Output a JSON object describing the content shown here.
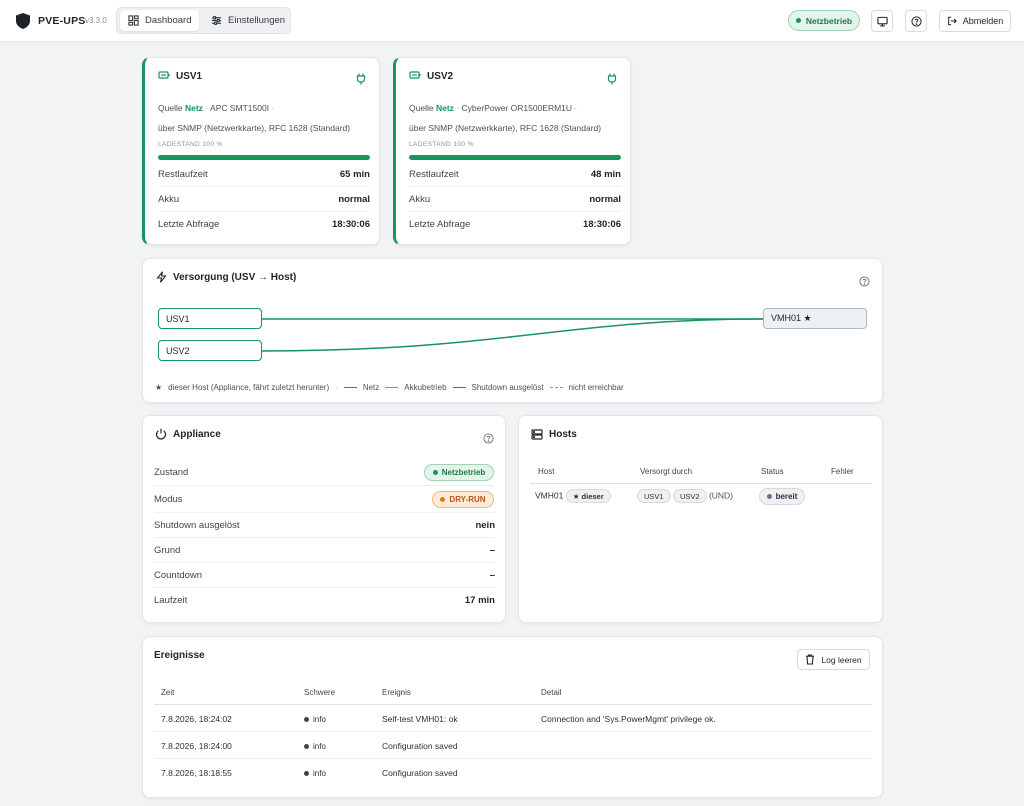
{
  "header": {
    "app_title": "PVE-UPS",
    "version": "v3.3.0",
    "tabs": [
      {
        "label": "Dashboard",
        "active": true
      },
      {
        "label": "Einstellungen",
        "active": false
      }
    ],
    "status_pill": "Netzbetrieb",
    "logout_label": "Abmelden",
    "icons": [
      "shield-icon",
      "monitor-icon",
      "help-icon",
      "logout-icon"
    ]
  },
  "colors": {
    "accent_green": "#17955a",
    "battery_orange": "#e07b24",
    "shutdown_red": "#d23b2b",
    "warning_orange": "#d9781c"
  },
  "ups": [
    {
      "name": "USV1",
      "source_label": "Quelle",
      "source_value": "Netz",
      "model": "APC SMT1500I",
      "connection": "über SNMP (Netzwerkkarte), RFC 1628 (Standard)",
      "charge_label": "LADESTAND 100 %",
      "charge_percent": 100,
      "rows": [
        {
          "key": "Restlaufzeit",
          "value": "65 min"
        },
        {
          "key": "Akku",
          "value": "normal"
        },
        {
          "key": "Letzte Abfrage",
          "value": "18:30:06"
        }
      ]
    },
    {
      "name": "USV2",
      "source_label": "Quelle",
      "source_value": "Netz",
      "model": "CyberPower OR1500ERM1U",
      "connection": "über SNMP (Netzwerkkarte), RFC 1628 (Standard)",
      "charge_label": "LADESTAND 100 %",
      "charge_percent": 100,
      "rows": [
        {
          "key": "Restlaufzeit",
          "value": "48 min"
        },
        {
          "key": "Akku",
          "value": "normal"
        },
        {
          "key": "Letzte Abfrage",
          "value": "18:30:06"
        }
      ]
    }
  ],
  "supply": {
    "title": "Versorgung (USV → Host)",
    "sources": [
      "USV1",
      "USV2"
    ],
    "host": "VMH01 ★",
    "legend": {
      "this_host": "dieser Host (Appliance, fährt zuletzt herunter)",
      "mains": "Netz",
      "battery": "Akkubetrieb",
      "shutdown": "Shutdown ausgelöst",
      "unreachable": "nicht erreichbar"
    }
  },
  "appliance": {
    "title": "Appliance",
    "rows": [
      {
        "key": "Zustand",
        "value": "Netzbetrieb"
      },
      {
        "key": "Modus",
        "value": "DRY-RUN"
      },
      {
        "key": "Shutdown ausgelöst",
        "value": "nein"
      },
      {
        "key": "Grund",
        "value": "–"
      },
      {
        "key": "Countdown",
        "value": "–"
      },
      {
        "key": "Laufzeit",
        "value": "17 min"
      }
    ]
  },
  "hosts": {
    "title": "Hosts",
    "columns": [
      "Host",
      "Versorgt durch",
      "Status",
      "Fehler"
    ],
    "rows": [
      {
        "host": "VMH01",
        "tag": "★ dieser",
        "ups": [
          "USV1",
          "USV2"
        ],
        "mode": "(UND)",
        "status": "bereit",
        "error": ""
      }
    ]
  },
  "events": {
    "title": "Ereignisse",
    "clear_label": "Log leeren",
    "columns": [
      "Zeit",
      "Schwere",
      "Ereignis",
      "Detail"
    ],
    "rows": [
      {
        "time": "7.8.2026, 18:24:02",
        "severity": "info",
        "event": "Self-test VMH01: ok",
        "detail": "Connection and 'Sys.PowerMgmt' privilege ok."
      },
      {
        "time": "7.8.2026, 18:24:00",
        "severity": "info",
        "event": "Configuration saved",
        "detail": ""
      },
      {
        "time": "7.8.2026, 18:18:55",
        "severity": "info",
        "event": "Configuration saved",
        "detail": ""
      }
    ]
  }
}
